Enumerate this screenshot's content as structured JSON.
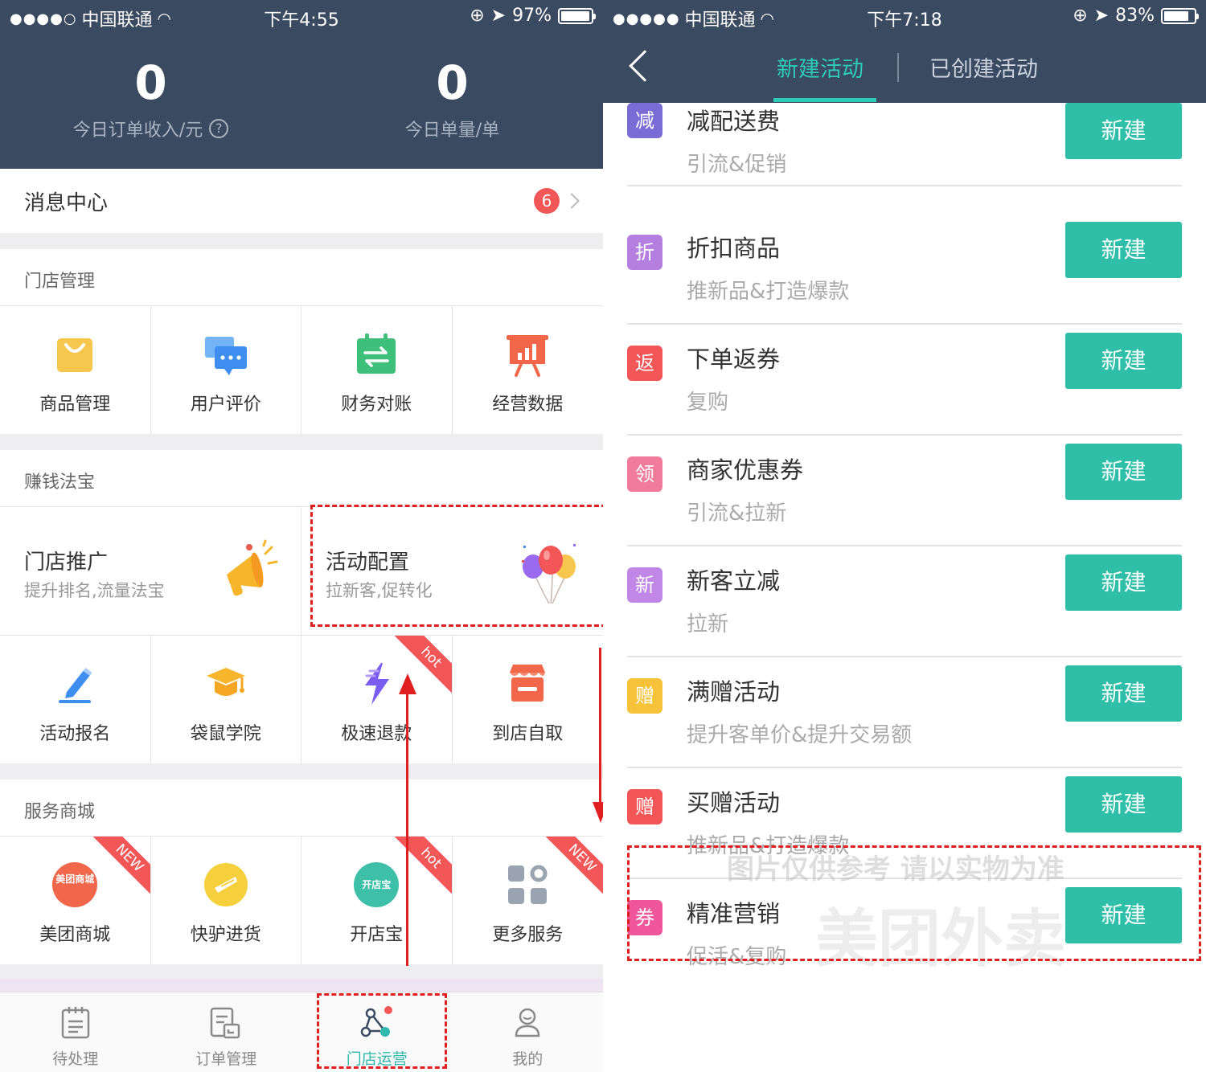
{
  "left_phone": {
    "status_bar": {
      "carrier": "中国联通",
      "time": "下午4:55",
      "battery": "97%",
      "battery_level": 0.97
    },
    "header_stats": [
      {
        "value": "0",
        "label": "今日订单收入/元",
        "help_icon": "?"
      },
      {
        "value": "0",
        "label": "今日单量/单"
      }
    ],
    "message_center": {
      "label": "消息中心",
      "badge": "6"
    },
    "store_management": {
      "title": "门店管理",
      "items": [
        {
          "label": "商品管理",
          "icon": "shopping-bag-icon",
          "color": "#f7c64d"
        },
        {
          "label": "用户评价",
          "icon": "chat-bubble-icon",
          "color": "#3d8ef0"
        },
        {
          "label": "财务对账",
          "icon": "calendar-transfer-icon",
          "color": "#3fc07a"
        },
        {
          "label": "经营数据",
          "icon": "presentation-chart-icon",
          "color": "#f2664a"
        }
      ]
    },
    "money_tools": {
      "title": "赚钱法宝",
      "promos": [
        {
          "title": "门店推广",
          "subtitle": "提升排名,流量法宝",
          "icon": "megaphone-icon"
        },
        {
          "title": "活动配置",
          "subtitle": "拉新客,促转化",
          "icon": "balloons-icon"
        }
      ],
      "items": [
        {
          "label": "活动报名",
          "icon": "pen-icon",
          "ribbon": ""
        },
        {
          "label": "袋鼠学院",
          "icon": "graduation-cap-icon",
          "ribbon": ""
        },
        {
          "label": "极速退款",
          "icon": "lightning-icon",
          "ribbon": "hot"
        },
        {
          "label": "到店自取",
          "icon": "storefront-icon",
          "ribbon": ""
        }
      ]
    },
    "service_mall": {
      "title": "服务商城",
      "items": [
        {
          "label": "美团商城",
          "icon": "meituan-mall-icon",
          "icon_text": "美团商城",
          "ribbon": "NEW"
        },
        {
          "label": "快驴进货",
          "icon": "donkey-icon",
          "icon_text": "",
          "ribbon": ""
        },
        {
          "label": "开店宝",
          "icon": "kaidianbao-icon",
          "icon_text": "开店宝",
          "ribbon": "hot"
        },
        {
          "label": "更多服务",
          "icon": "grid-more-icon",
          "icon_text": "",
          "ribbon": "NEW"
        }
      ]
    },
    "tab_bar": [
      {
        "label": "待处理",
        "icon": "clipboard-icon",
        "active": false
      },
      {
        "label": "订单管理",
        "icon": "order-doc-icon",
        "active": false
      },
      {
        "label": "门店运营",
        "icon": "nodes-icon",
        "active": true
      },
      {
        "label": "我的",
        "icon": "person-icon",
        "active": false
      }
    ]
  },
  "right_phone": {
    "status_bar": {
      "carrier": "中国联通",
      "time": "下午7:18",
      "battery": "83%",
      "battery_level": 0.83
    },
    "nav": {
      "tab_active": "新建活动",
      "tab_inactive": "已创建活动"
    },
    "button_label": "新建",
    "activities": [
      {
        "tag": "减",
        "tag_color": "#7a6bd6",
        "name": "减配送费",
        "desc": "引流&促销"
      },
      {
        "tag": "折",
        "tag_color": "#b57fe0",
        "name": "折扣商品",
        "desc": "推新品&打造爆款"
      },
      {
        "tag": "返",
        "tag_color": "#f25656",
        "name": "下单返券",
        "desc": "复购"
      },
      {
        "tag": "领",
        "tag_color": "#f07b9a",
        "name": "商家优惠券",
        "desc": "引流&拉新"
      },
      {
        "tag": "新",
        "tag_color": "#c187e6",
        "name": "新客立减",
        "desc": "拉新"
      },
      {
        "tag": "赠",
        "tag_color": "#f5c23a",
        "name": "满赠活动",
        "desc": "提升客单价&提升交易额"
      },
      {
        "tag": "赠",
        "tag_color": "#f25656",
        "name": "买赠活动",
        "desc": "推新品&打造爆款"
      },
      {
        "tag": "券",
        "tag_color": "#f0569a",
        "name": "精准营销",
        "desc": "促活&复购"
      }
    ],
    "watermark": {
      "line1": "图片仅供参考 请以实物为准",
      "line2": "美团外卖"
    }
  }
}
